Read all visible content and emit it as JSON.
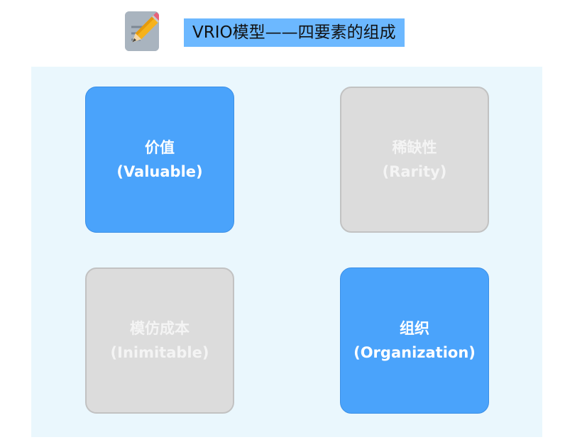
{
  "header": {
    "icon": "memo-pencil-icon",
    "title": "VRIO模型——四要素的组成"
  },
  "cards": [
    {
      "label": "价值",
      "sublabel": "(Valuable)",
      "highlighted": true
    },
    {
      "label": "稀缺性",
      "sublabel": "(Rarity)",
      "highlighted": false
    },
    {
      "label": "模仿成本",
      "sublabel": "(Inimitable)",
      "highlighted": false
    },
    {
      "label": "组织",
      "sublabel": "(Organization)",
      "highlighted": true
    }
  ],
  "colors": {
    "highlight": "#4aa3fb",
    "inactive": "#dcdcdc",
    "panel_background": "#eaf7fd",
    "title_background": "#6cb8ff"
  }
}
